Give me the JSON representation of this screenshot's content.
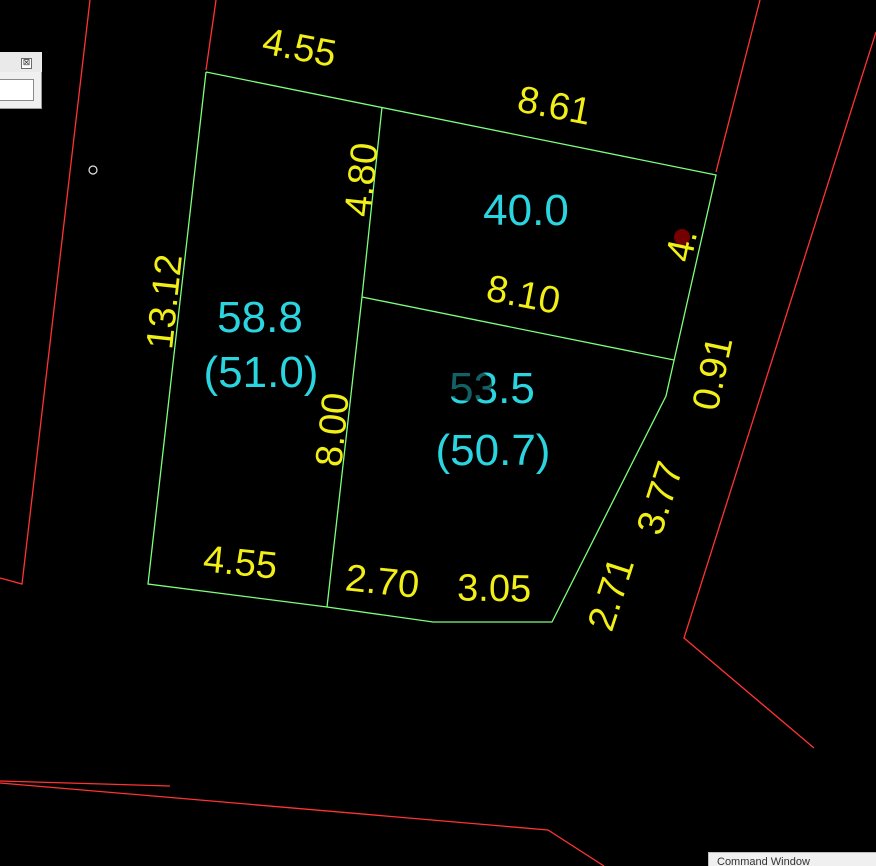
{
  "drawing": {
    "background": "#000000",
    "colors": {
      "boundary_lines": "#ff3333",
      "parcel_lines": "#7dff7d",
      "dimension_text": "#f2ef16",
      "area_text": "#2bd5df",
      "obscuring_mark": "#8a0000"
    },
    "dimensions": {
      "top_left": "4.55",
      "top_right": "8.61",
      "left_side": "13.12",
      "divider_upper": "4.80",
      "mid_divider": "8.10",
      "right_upper": "4.",
      "right_lower": "0.91",
      "divider_lower": "8.00",
      "bottom_left": "4.55",
      "bottom_mid": "2.70",
      "bottom_right": "3.05",
      "chamfer_upper": "3.77",
      "chamfer_lower": "2.71"
    },
    "areas": {
      "left_lot": "58.8",
      "left_lot_secondary": "(51.0)",
      "upper_right_lot": "40.0",
      "lower_right_lot": "53.5",
      "lower_right_lot_secondary": "(50.7)"
    }
  },
  "palette": {
    "close_glyph": "⊠"
  },
  "command_window": {
    "title": "Command Window"
  }
}
